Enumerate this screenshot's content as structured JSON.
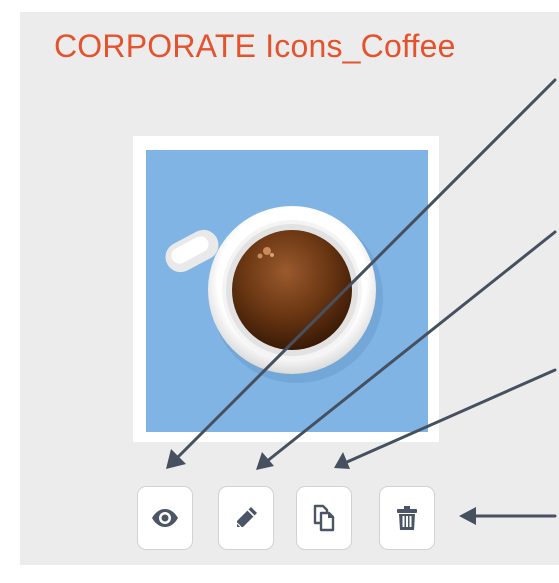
{
  "title": "CORPORATE Icons_Coffee",
  "thumbnail": {
    "subject": "coffee-cup-icon",
    "background_color": "#7fb4e4"
  },
  "actions": [
    {
      "name": "view-button",
      "icon": "eye-icon"
    },
    {
      "name": "edit-button",
      "icon": "pencil-icon"
    },
    {
      "name": "duplicate-button",
      "icon": "copy-icon"
    },
    {
      "name": "delete-button",
      "icon": "trash-icon"
    }
  ],
  "colors": {
    "title": "#e5532e",
    "icon": "#4b5566",
    "arrow": "#46505f",
    "panel": "#ececec"
  }
}
